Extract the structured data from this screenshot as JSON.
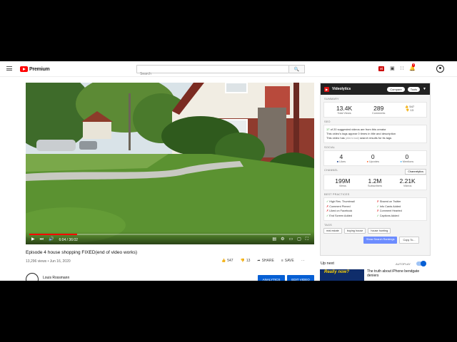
{
  "masthead": {
    "logo_text": "Premium",
    "search_placeholder": "Search",
    "vi_badge": "Vi",
    "notification_count": "9"
  },
  "player": {
    "progress": 0.17,
    "time": "6:04 / 36:02"
  },
  "video": {
    "title": "Episode 4 house shopping FIXED(end of video works)",
    "meta": "13,296 views • Jun 16, 2020",
    "likes": "547",
    "dislikes": "13",
    "share": "SHARE",
    "save": "SAVE",
    "channel": "Louis Rossmann",
    "analytics_button": "ANALYTICS",
    "edit_button": "EDIT VIDEO"
  },
  "panel": {
    "name": "Videolytics",
    "compare": "Compare",
    "tools": "Tools",
    "summary_label": "SUMMARY",
    "summary": {
      "views": "13.4K",
      "views_label": "Total Views",
      "comments": "289",
      "comments_label": "Comments",
      "likes": "547",
      "dislikes": "13"
    },
    "seo_label": "SEO",
    "seo": {
      "line1_highlight": "17",
      "line1_rest": "of 20 suggested videos are from this creator",
      "line2": "This video's tags appear 0 times in title and description",
      "line3": "This video has",
      "line3_sub": "(click to load)",
      "line3_rest": "search results for its tags"
    },
    "social_label": "SOCIAL",
    "social": {
      "likes": "4",
      "likes_label": "Likes",
      "upvotes": "0",
      "upvotes_label": "Upvotes",
      "mentions": "0",
      "mentions_label": "Mentions"
    },
    "channel_label": "CHANNEL",
    "channelgraph_button": "Channelytics",
    "channel": {
      "views": "199M",
      "views_label": "Views",
      "subs": "1.2M",
      "subs_label": "Subscribers",
      "videos": "2.21K",
      "videos_label": "Videos"
    },
    "best_label": "BEST PRACTICES",
    "best_practices": [
      {
        "text": "High Res. Thumbnail",
        "ok": true
      },
      {
        "text": "Shared on Twitter",
        "ok": false
      },
      {
        "text": "Comment Pinned",
        "ok": false
      },
      {
        "text": "Info Cards Added",
        "ok": true
      },
      {
        "text": "Liked on Facebook",
        "ok": false
      },
      {
        "text": "Comment Hearted",
        "ok": false
      },
      {
        "text": "End Screen Added",
        "ok": true
      },
      {
        "text": "Captions Added",
        "ok": true
      }
    ],
    "tags_label": "TAGS",
    "tags": [
      "real estate",
      "buying house",
      "house hunting"
    ],
    "show_rankings": "Show Search Rankings",
    "copy_to": "Copy To..."
  },
  "upnext": {
    "label": "Up next",
    "autoplay": "AUTOPLAY",
    "thumb_text": "Really now?",
    "next_title": "The truth about iPhone bendgate deniers"
  }
}
